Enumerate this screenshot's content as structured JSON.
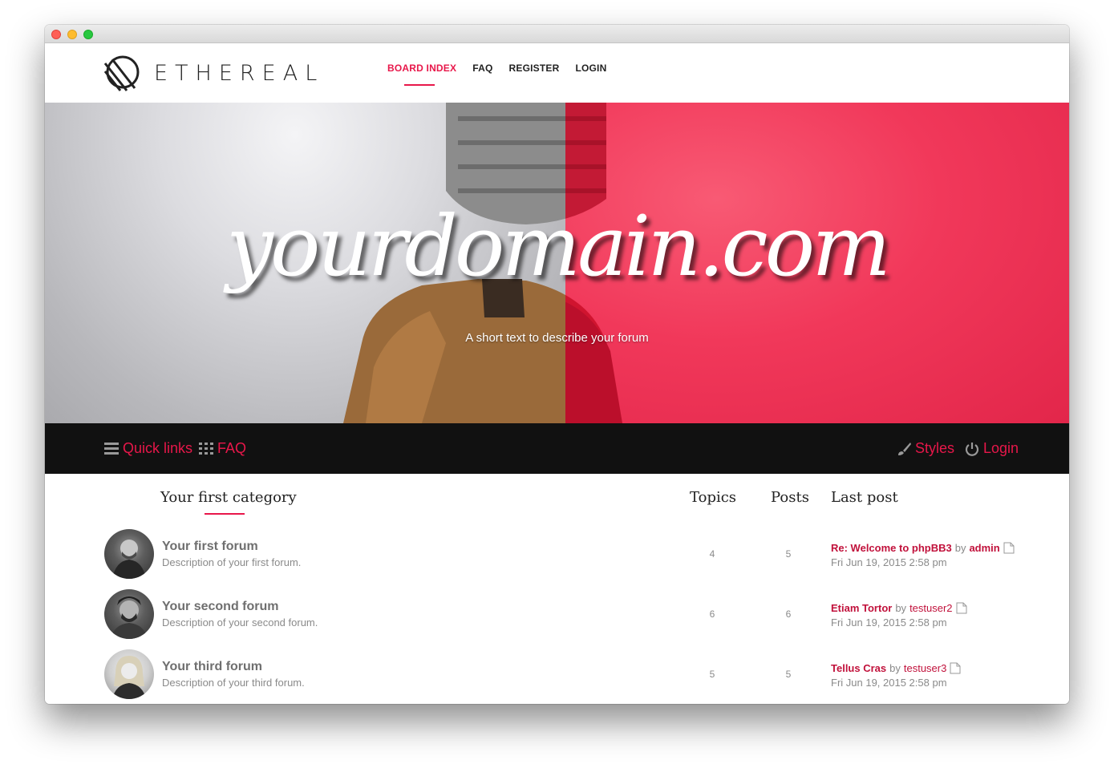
{
  "brand": {
    "name": "ETHEREAL",
    "accent_color": "#e8174a"
  },
  "topnav": {
    "items": [
      {
        "label": "BOARD INDEX",
        "active": true
      },
      {
        "label": "FAQ",
        "active": false
      },
      {
        "label": "REGISTER",
        "active": false
      },
      {
        "label": "LOGIN",
        "active": false
      }
    ]
  },
  "hero": {
    "title": "yourdomain.com",
    "subtitle": "A short text to describe your forum"
  },
  "subbar": {
    "quick_links": {
      "label": "Quick links",
      "icon": "hamburger-icon"
    },
    "faq": {
      "label": "FAQ",
      "icon": "grid-icon"
    },
    "styles": {
      "label": "Styles",
      "icon": "brush-icon"
    },
    "login": {
      "label": "Login",
      "icon": "power-icon"
    }
  },
  "forum_table": {
    "category": "Your first category",
    "columns": {
      "topics": "Topics",
      "posts": "Posts",
      "last_post": "Last post"
    },
    "rows": [
      {
        "name": "Your first forum",
        "description": "Description of your first forum.",
        "topics": "4",
        "posts": "5",
        "last_post": {
          "title": "Re: Welcome to phpBB3",
          "by": "by",
          "user": "admin",
          "date": "Fri Jun 19, 2015 2:58 pm"
        }
      },
      {
        "name": "Your second forum",
        "description": "Description of your second forum.",
        "topics": "6",
        "posts": "6",
        "last_post": {
          "title": "Etiam Tortor",
          "by": "by",
          "user": "testuser2",
          "date": "Fri Jun 19, 2015 2:58 pm"
        }
      },
      {
        "name": "Your third forum",
        "description": "Description of your third forum.",
        "topics": "5",
        "posts": "5",
        "last_post": {
          "title": "Tellus Cras",
          "by": "by",
          "user": "testuser3",
          "date": "Fri Jun 19, 2015 2:58 pm"
        }
      }
    ]
  }
}
